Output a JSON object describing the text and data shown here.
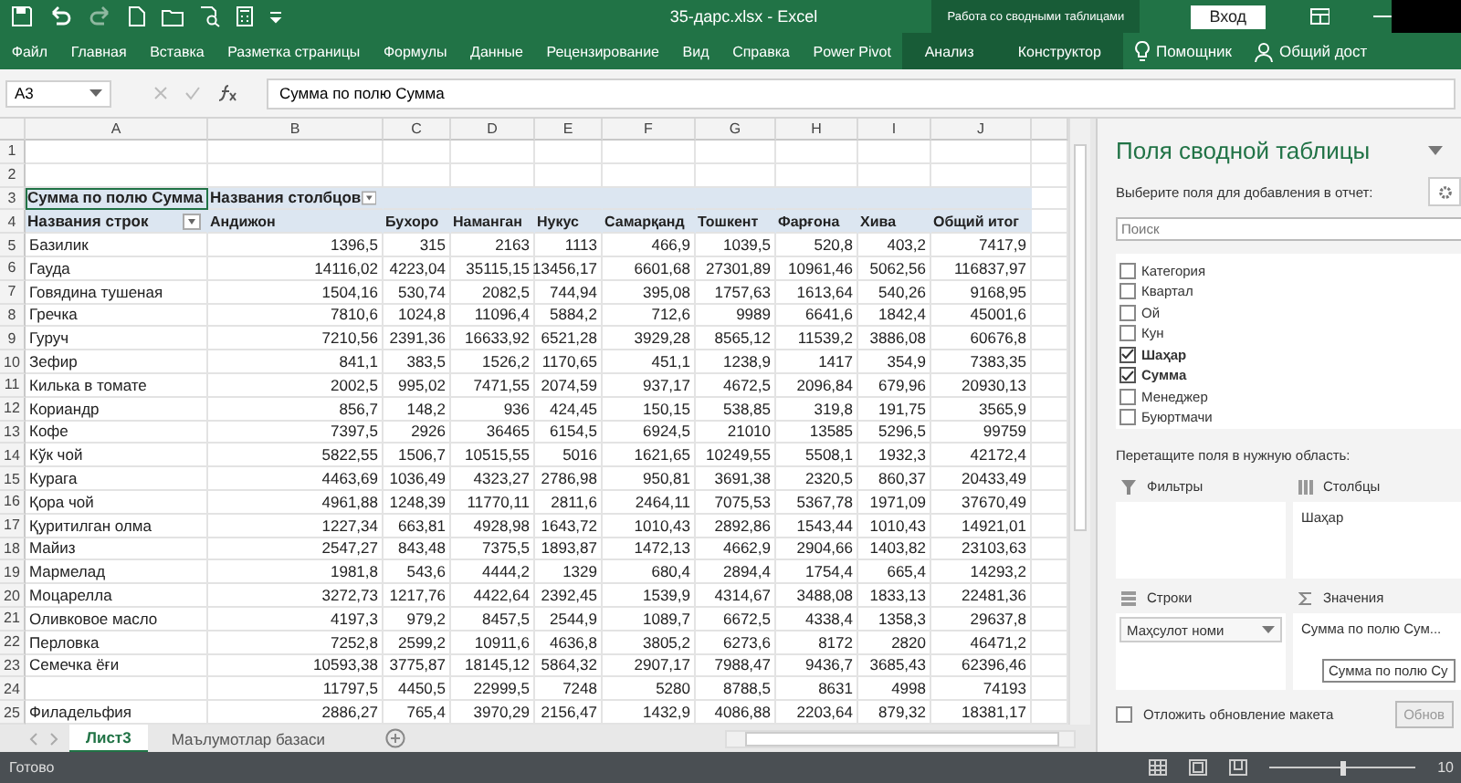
{
  "title_bar": {
    "title": "35-дарс.xlsx  -  Excel",
    "context_label": "Работа со сводными таблицами",
    "sign_in": "Вход"
  },
  "ribbon_tabs": [
    {
      "label": "Файл",
      "contextual": false
    },
    {
      "label": "Главная",
      "contextual": false
    },
    {
      "label": "Вставка",
      "contextual": false
    },
    {
      "label": "Разметка страницы",
      "contextual": false
    },
    {
      "label": "Формулы",
      "contextual": false
    },
    {
      "label": "Данные",
      "contextual": false
    },
    {
      "label": "Рецензирование",
      "contextual": false
    },
    {
      "label": "Вид",
      "contextual": false
    },
    {
      "label": "Справка",
      "contextual": false
    },
    {
      "label": "Power Pivot",
      "contextual": false
    },
    {
      "label": "Анализ",
      "contextual": true
    },
    {
      "label": "Конструктор",
      "contextual": true
    }
  ],
  "tell_me": "Помощник",
  "share": "Общий дост",
  "formula_bar": {
    "name_box": "A3",
    "formula": "Сумма по полю Сумма"
  },
  "column_headers": [
    "A",
    "B",
    "C",
    "D",
    "E",
    "F",
    "G",
    "H",
    "I",
    "J"
  ],
  "row_numbers": [
    "1",
    "2",
    "3",
    "4",
    "5",
    "6",
    "7",
    "8",
    "9",
    "10",
    "11",
    "12",
    "13",
    "14",
    "15",
    "16",
    "17",
    "18",
    "19",
    "20",
    "21",
    "22",
    "23",
    "24",
    "25"
  ],
  "pivot": {
    "corner": "Сумма по полю Сумма",
    "corner_selected": true,
    "column_field": "Названия столбцов",
    "row_field": "Названия строк",
    "columns": [
      "Андижон",
      "Бухоро",
      "Наманган",
      "Нукус",
      "Самарқанд",
      "Тошкент",
      "Фарғона",
      "Хива",
      "Общий итог"
    ],
    "rows": [
      {
        "label": "Базилик",
        "values": [
          "1396,5",
          "315",
          "2163",
          "1113",
          "466,9",
          "1039,5",
          "520,8",
          "403,2",
          "7417,9"
        ]
      },
      {
        "label": "Гауда",
        "values": [
          "14116,02",
          "4223,04",
          "35115,15",
          "13456,17",
          "6601,68",
          "27301,89",
          "10961,46",
          "5062,56",
          "116837,97"
        ]
      },
      {
        "label": "Говядина тушеная",
        "values": [
          "1504,16",
          "530,74",
          "2082,5",
          "744,94",
          "395,08",
          "1757,63",
          "1613,64",
          "540,26",
          "9168,95"
        ]
      },
      {
        "label": "Гречка",
        "values": [
          "7810,6",
          "1024,8",
          "11096,4",
          "5884,2",
          "712,6",
          "9989",
          "6641,6",
          "1842,4",
          "45001,6"
        ]
      },
      {
        "label": "Гуруч",
        "values": [
          "7210,56",
          "2391,36",
          "16633,92",
          "6521,28",
          "3929,28",
          "8565,12",
          "11539,2",
          "3886,08",
          "60676,8"
        ]
      },
      {
        "label": "Зефир",
        "values": [
          "841,1",
          "383,5",
          "1526,2",
          "1170,65",
          "451,1",
          "1238,9",
          "1417",
          "354,9",
          "7383,35"
        ]
      },
      {
        "label": "Килька в томате",
        "values": [
          "2002,5",
          "995,02",
          "7471,55",
          "2074,59",
          "937,17",
          "4672,5",
          "2096,84",
          "679,96",
          "20930,13"
        ]
      },
      {
        "label": "Кориандр",
        "values": [
          "856,7",
          "148,2",
          "936",
          "424,45",
          "150,15",
          "538,85",
          "319,8",
          "191,75",
          "3565,9"
        ]
      },
      {
        "label": "Кофе",
        "values": [
          "7397,5",
          "2926",
          "36465",
          "6154,5",
          "6924,5",
          "21010",
          "13585",
          "5296,5",
          "99759"
        ]
      },
      {
        "label": "Кўк чой",
        "values": [
          "5822,55",
          "1506,7",
          "10515,55",
          "5016",
          "1621,65",
          "10249,55",
          "5508,1",
          "1932,3",
          "42172,4"
        ]
      },
      {
        "label": "Курага",
        "values": [
          "4463,69",
          "1036,49",
          "4323,27",
          "2786,98",
          "950,81",
          "3691,38",
          "2320,5",
          "860,37",
          "20433,49"
        ]
      },
      {
        "label": "Қора чой",
        "values": [
          "4961,88",
          "1248,39",
          "11770,11",
          "2811,6",
          "2464,11",
          "7075,53",
          "5367,78",
          "1971,09",
          "37670,49"
        ]
      },
      {
        "label": "Қуритилган олма",
        "values": [
          "1227,34",
          "663,81",
          "4928,98",
          "1643,72",
          "1010,43",
          "2892,86",
          "1543,44",
          "1010,43",
          "14921,01"
        ]
      },
      {
        "label": "Майиз",
        "values": [
          "2547,27",
          "843,48",
          "7375,5",
          "1893,87",
          "1472,13",
          "4662,9",
          "2904,66",
          "1403,82",
          "23103,63"
        ]
      },
      {
        "label": "Мармелад",
        "values": [
          "1981,8",
          "543,6",
          "4444,2",
          "1329",
          "680,4",
          "2894,4",
          "1754,4",
          "665,4",
          "14293,2"
        ]
      },
      {
        "label": "Моцарелла",
        "values": [
          "3272,73",
          "1217,76",
          "4422,64",
          "2392,45",
          "1539,9",
          "4314,67",
          "3488,08",
          "1833,13",
          "22481,36"
        ]
      },
      {
        "label": "Оливковое масло",
        "values": [
          "4197,3",
          "979,2",
          "8457,5",
          "2544,9",
          "1089,7",
          "6672,5",
          "4338,4",
          "1358,3",
          "29637,8"
        ]
      },
      {
        "label": "Перловка",
        "values": [
          "7252,8",
          "2599,2",
          "10911,6",
          "4636,8",
          "3805,2",
          "6273,6",
          "8172",
          "2820",
          "46471,2"
        ]
      },
      {
        "label": "Семечка ёғи",
        "values": [
          "10593,38",
          "3775,87",
          "18145,12",
          "5864,32",
          "2907,17",
          "7988,47",
          "9436,7",
          "3685,43",
          "62396,46"
        ]
      },
      {
        "values": [
          "11797,5",
          "4450,5",
          "22999,5",
          "7248",
          "5280",
          "8788,5",
          "8631",
          "4998",
          "74193"
        ]
      },
      {
        "label": "Филадельфия",
        "values": [
          "2886,27",
          "765,4",
          "3970,29",
          "2156,47",
          "1432,9",
          "4086,88",
          "2203,64",
          "879,32",
          "18381,17"
        ]
      }
    ]
  },
  "sheet_tabs": [
    {
      "label": "Лист3",
      "selected": true
    },
    {
      "label": "Маълумотлар базаси",
      "selected": false
    }
  ],
  "field_pane": {
    "title": "Поля сводной таблицы",
    "subtitle": "Выберите поля для добавления в отчет:",
    "search": {
      "placeholder": "Поиск"
    },
    "fields": [
      {
        "label": "Категория",
        "checked": false
      },
      {
        "label": "Квартал",
        "checked": false
      },
      {
        "label": "Ой",
        "checked": false
      },
      {
        "label": "Кун",
        "checked": false
      },
      {
        "label": "Шаҳар",
        "checked": true
      },
      {
        "label": "Сумма",
        "checked": true
      },
      {
        "label": "Менеджер",
        "checked": false
      },
      {
        "label": "Буюртмачи",
        "checked": false
      }
    ],
    "drag_hint": "Перетащите поля в нужную область:",
    "areas": [
      {
        "kind": "filters",
        "title": "Фильтры"
      },
      {
        "kind": "columns",
        "title": "Столбцы",
        "items": [
          "Шаҳар"
        ]
      },
      {
        "kind": "rows",
        "title": "Строки",
        "items": [
          "Маҳсулот номи"
        ]
      },
      {
        "kind": "values",
        "title": "Значения",
        "items": [
          "Сумма по полю Сум..."
        ]
      }
    ],
    "tooltip": "Сумма по полю Су",
    "defer": {
      "label": "Отложить обновление макета",
      "checked": false
    },
    "update_button": "Обнов"
  },
  "status_bar": {
    "status": "Готово",
    "zoom_slider": {
      "level": 0.5
    },
    "zoom_label": "10"
  }
}
